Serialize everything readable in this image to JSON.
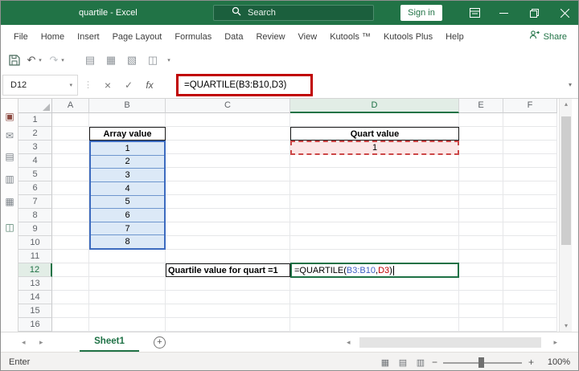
{
  "titlebar": {
    "title": "quartile - Excel",
    "search_label": "Search",
    "sign_in_label": "Sign in"
  },
  "ribbon_tabs": [
    "File",
    "Home",
    "Insert",
    "Page Layout",
    "Formulas",
    "Data",
    "Review",
    "View",
    "Kutools ™",
    "Kutools Plus",
    "Help"
  ],
  "share_label": "Share",
  "formula_bar": {
    "name_box_value": "D12",
    "fx_label": "fx",
    "formula_text": "=QUARTILE(B3:B10,D3)"
  },
  "grid": {
    "column_headers": [
      "A",
      "B",
      "C",
      "D",
      "E",
      "F"
    ],
    "row_numbers": [
      "1",
      "2",
      "3",
      "4",
      "5",
      "6",
      "7",
      "8",
      "9",
      "10",
      "11",
      "12",
      "13",
      "14",
      "15",
      "16"
    ],
    "selected_column": "D",
    "selected_row": "12",
    "cells": {
      "array_header": "Array value",
      "array_values": [
        "1",
        "2",
        "3",
        "4",
        "5",
        "6",
        "7",
        "8"
      ],
      "quart_header": "Quart value",
      "quart_value": "1",
      "quartile_label": "Quartile value for quart =1",
      "formula_parts": [
        {
          "text": "=QUARTILE(",
          "color": "#000000"
        },
        {
          "text": "B3:B10",
          "color": "#3c5ec2"
        },
        {
          "text": ",",
          "color": "#000000"
        },
        {
          "text": "D3",
          "color": "#c00000"
        },
        {
          "text": ")",
          "color": "#000000"
        }
      ]
    }
  },
  "sheet_bar": {
    "active_tab": "Sheet1"
  },
  "status_bar": {
    "mode": "Enter",
    "zoom_level": "100%"
  },
  "icons": {
    "undo": "↶",
    "redo": "↷",
    "dropdown": "▾",
    "qat_icon_1": "▤",
    "qat_icon_2": "▦",
    "qat_icon_3": "▧",
    "qat_icon_4": "◫",
    "cancel": "×",
    "enter_check": "✓",
    "separator": "⋮",
    "pane_icon_1": "▣",
    "pane_icon_2": "✉",
    "pane_icon_3": "▤",
    "pane_icon_4": "▥",
    "pane_icon_5": "▦",
    "pane_icon_6": "◫",
    "sheet_prev": "◂",
    "sheet_next": "▸",
    "add_sheet": "+",
    "scroll_up": "▴",
    "scroll_down": "▾",
    "scroll_left": "◂",
    "scroll_right": "▸",
    "view_normal": "▦",
    "view_layout": "▤",
    "view_break": "▥",
    "zoom_out": "−",
    "zoom_in": "+"
  },
  "colors": {
    "excel_green": "#217346",
    "annotation_red": "#c00000",
    "reference_blue": "#3c5ec2",
    "reference_red": "#c00000",
    "array_fill": "#dce9f7",
    "quart_fill": "#fbe7e7"
  }
}
